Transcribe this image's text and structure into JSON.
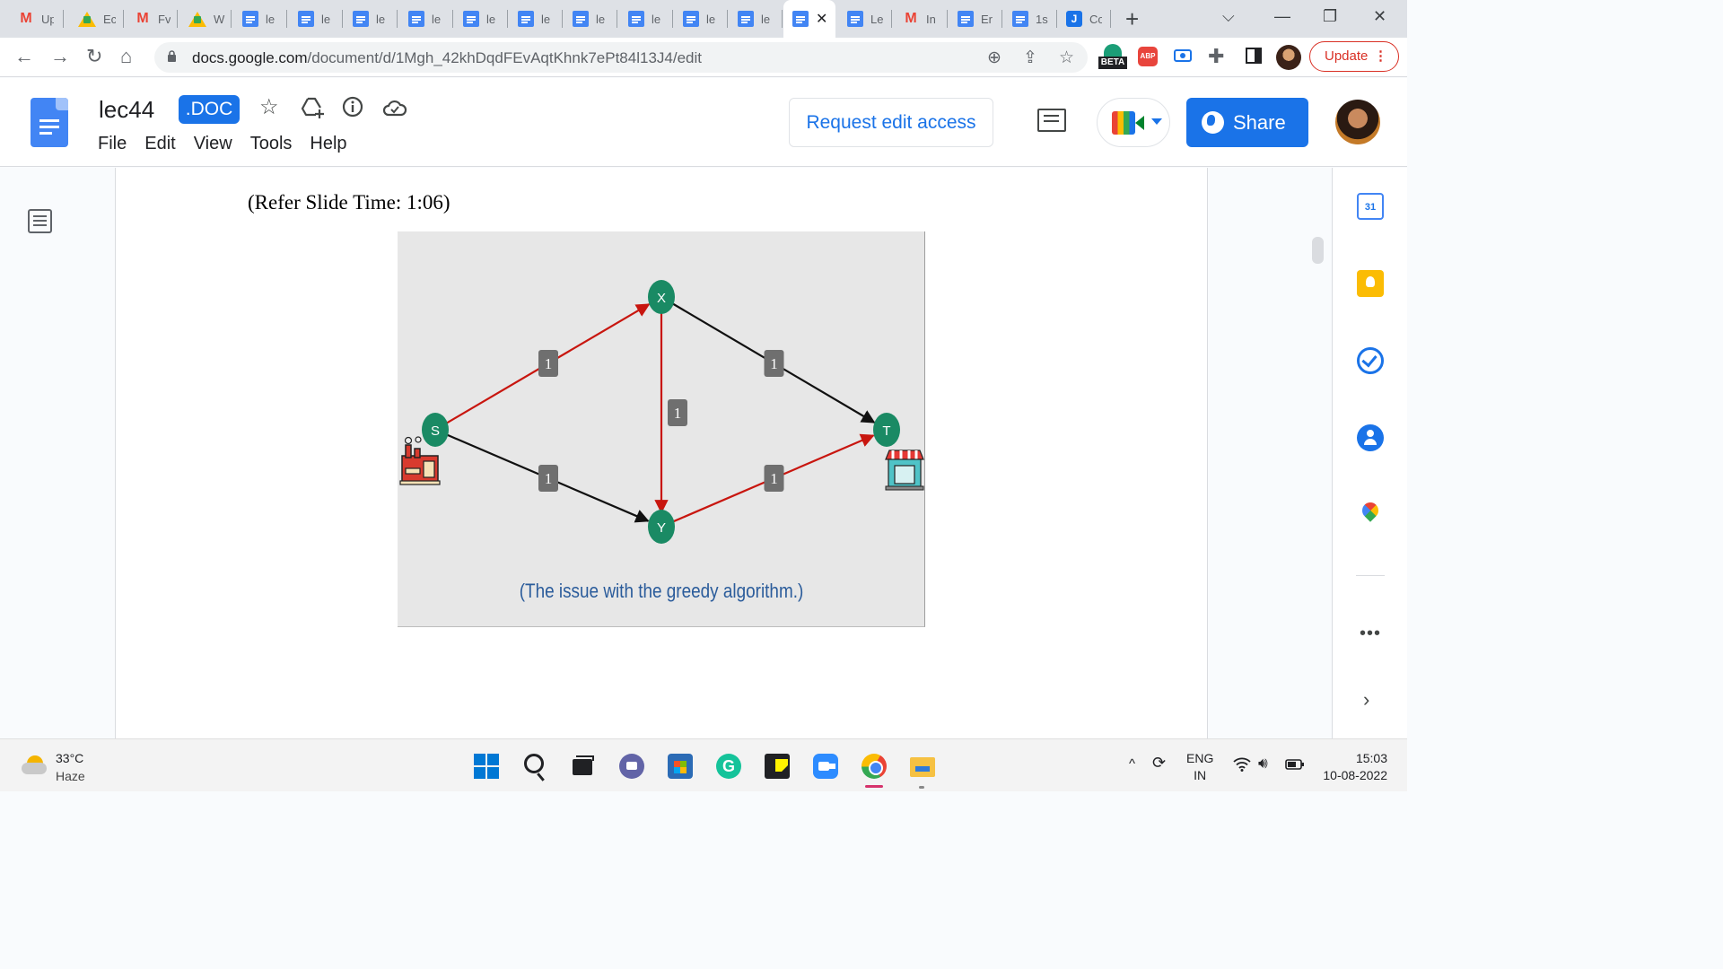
{
  "browser": {
    "tabs": [
      {
        "icon": "gmail",
        "title": "Up"
      },
      {
        "icon": "drive",
        "title": "Ec"
      },
      {
        "icon": "gmail",
        "title": "Fv"
      },
      {
        "icon": "drive",
        "title": "W"
      },
      {
        "icon": "docs",
        "title": "le"
      },
      {
        "icon": "docs",
        "title": "le"
      },
      {
        "icon": "docs",
        "title": "le"
      },
      {
        "icon": "docs",
        "title": "le"
      },
      {
        "icon": "docs",
        "title": "le"
      },
      {
        "icon": "docs",
        "title": "le"
      },
      {
        "icon": "docs",
        "title": "le"
      },
      {
        "icon": "docs",
        "title": "le"
      },
      {
        "icon": "docs",
        "title": "le"
      },
      {
        "icon": "docs",
        "title": "le"
      },
      {
        "icon": "docs",
        "title": "",
        "active": true
      },
      {
        "icon": "docs",
        "title": "Le"
      },
      {
        "icon": "gmail",
        "title": "In"
      },
      {
        "icon": "docs",
        "title": "Er"
      },
      {
        "icon": "docs",
        "title": "1s"
      },
      {
        "icon": "jav",
        "title": "Co"
      }
    ],
    "url_host": "docs.google.com",
    "url_path": "/document/d/1Mgh_42khDqdFEvAqtKhnk7ePt84l13J4/edit",
    "beta_label": "BETA",
    "abp_label": "ABP",
    "update_label": "Update"
  },
  "docs": {
    "title": "lec44",
    "badge": ".DOC",
    "menu": [
      "File",
      "Edit",
      "View",
      "Tools",
      "Help"
    ],
    "request_edit_label": "Request edit access",
    "share_label": "Share"
  },
  "document": {
    "slide_time": "(Refer Slide Time: 1:06)",
    "caption": "(The issue with the greedy algorithm.)"
  },
  "graph": {
    "nodes": [
      {
        "id": "S",
        "label": "S"
      },
      {
        "id": "X",
        "label": "X"
      },
      {
        "id": "Y",
        "label": "Y"
      },
      {
        "id": "T",
        "label": "T"
      }
    ],
    "edges": [
      {
        "from": "S",
        "to": "X",
        "weight": "1",
        "color": "#c8160f"
      },
      {
        "from": "X",
        "to": "T",
        "weight": "1",
        "color": "#111111"
      },
      {
        "from": "X",
        "to": "Y",
        "weight": "1",
        "color": "#c8160f"
      },
      {
        "from": "S",
        "to": "Y",
        "weight": "1",
        "color": "#111111"
      },
      {
        "from": "Y",
        "to": "T",
        "weight": "1",
        "color": "#c8160f"
      }
    ],
    "node_color": "#1a8a64"
  },
  "sidepanel": {
    "calendar_label": "31"
  },
  "taskbar": {
    "temperature": "33°C",
    "weather": "Haze",
    "lang_top": "ENG",
    "lang_bottom": "IN",
    "time": "15:03",
    "date": "10-08-2022"
  },
  "colors": {
    "accent": "#1a73e8",
    "update_red": "#d93025",
    "caption_blue": "#2b5c9b"
  }
}
